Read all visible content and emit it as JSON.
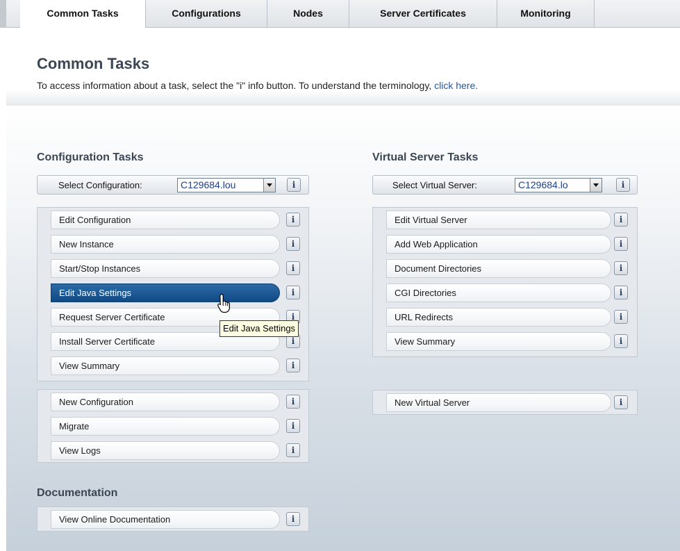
{
  "tabs": [
    "Common Tasks",
    "Configurations",
    "Nodes",
    "Server Certificates",
    "Monitoring"
  ],
  "active_tab": "Common Tasks",
  "page": {
    "title": "Common Tasks",
    "description": "To access information about a task, select the \"i\" info button. To understand the terminology, ",
    "link": "click here."
  },
  "config": {
    "title": "Configuration Tasks",
    "select_label": "Select Configuration:",
    "select_value": "C129684.lou",
    "group1": [
      "Edit Configuration",
      "New Instance",
      "Start/Stop Instances",
      "Edit Java Settings",
      "Request Server Certificate",
      "Install Server Certificate",
      "View Summary"
    ],
    "group2": [
      "New Configuration",
      "Migrate",
      "View Logs"
    ],
    "highlighted": "Edit Java Settings"
  },
  "docs": {
    "title": "Documentation",
    "items": [
      "View Online Documentation"
    ]
  },
  "vs": {
    "title": "Virtual Server Tasks",
    "select_label": "Select Virtual Server:",
    "select_value": "C129684.lo",
    "group1": [
      "Edit Virtual Server",
      "Add Web Application",
      "Document Directories",
      "CGI Directories",
      "URL Redirects",
      "View Summary"
    ],
    "group2": [
      "New Virtual Server"
    ]
  },
  "info_label": "i",
  "tooltip": "Edit Java Settings",
  "icons": {
    "info": "info-icon",
    "dropdown": "chevron-down-icon",
    "cursor": "hand-pointer-icon"
  },
  "colors": {
    "accent": "#1a5690",
    "link": "#2457a6",
    "heading": "#3a4654"
  }
}
